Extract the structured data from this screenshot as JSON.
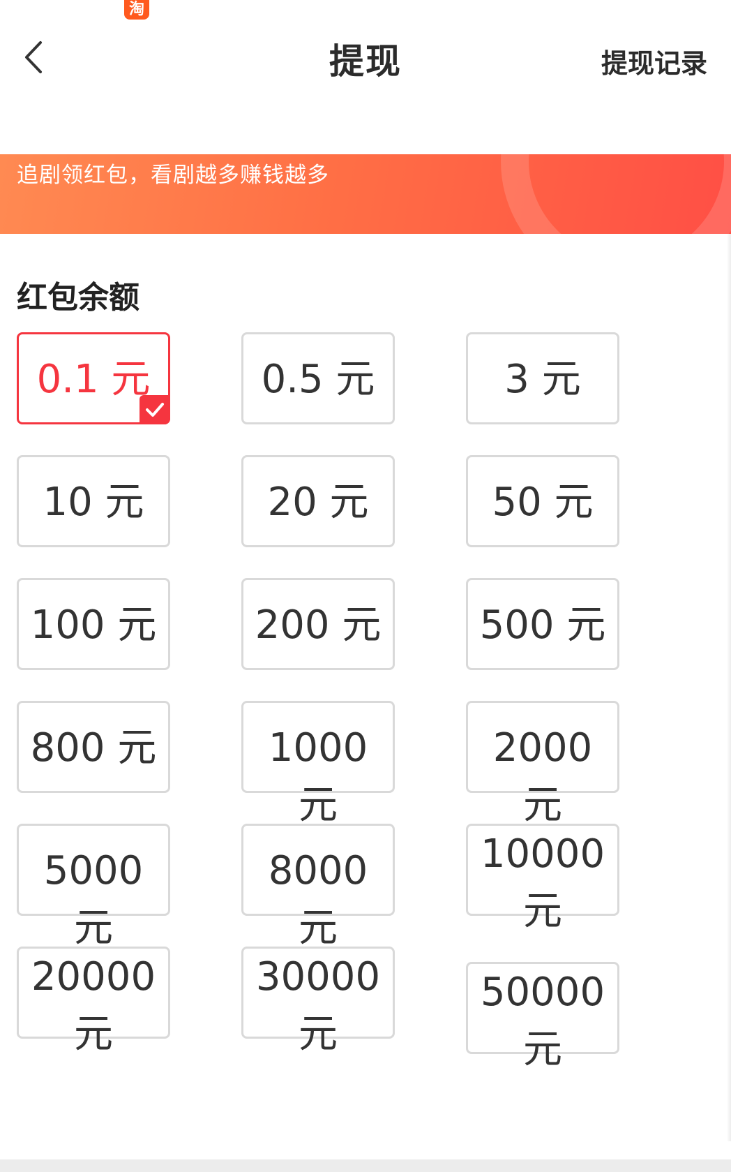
{
  "status": {
    "app_icon_glyph": "淘"
  },
  "header": {
    "back_icon": "chevron-left-icon",
    "title": "提现",
    "record_link": "提现记录"
  },
  "banner": {
    "text": "追剧领红包，看剧越多赚钱越多",
    "gradient_start": "#ff8a52",
    "gradient_end": "#ff4f45"
  },
  "section": {
    "title": "红包余额"
  },
  "amounts": [
    {
      "label": "0.1 元",
      "selected": true
    },
    {
      "label": "0.5 元",
      "selected": false
    },
    {
      "label": "3 元",
      "selected": false
    },
    {
      "label": "10 元",
      "selected": false
    },
    {
      "label": "20 元",
      "selected": false
    },
    {
      "label": "50 元",
      "selected": false
    },
    {
      "label": "100 元",
      "selected": false
    },
    {
      "label": "200 元",
      "selected": false
    },
    {
      "label": "500 元",
      "selected": false
    },
    {
      "label": "800 元",
      "selected": false
    },
    {
      "label": "1000 元",
      "selected": false
    },
    {
      "label": "2000 元",
      "selected": false
    },
    {
      "label": "5000 元",
      "selected": false
    },
    {
      "label": "8000 元",
      "selected": false
    },
    {
      "label": "10000 元",
      "selected": false
    },
    {
      "label": "20000 元",
      "selected": false
    },
    {
      "label": "30000 元",
      "selected": false
    },
    {
      "label": "50000 元",
      "selected": false
    }
  ],
  "colors": {
    "accent": "#f5353f",
    "card_border": "#d9d9d9",
    "text": "#333333"
  }
}
